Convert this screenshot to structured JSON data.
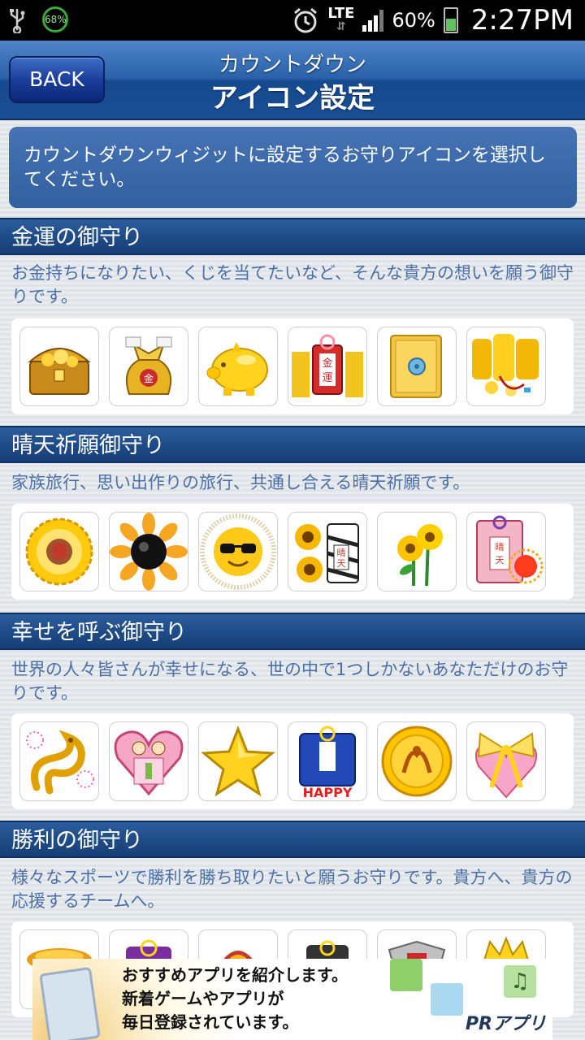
{
  "status_bar": {
    "battery_circle": "68%",
    "network": "LTE",
    "battery_percent": "60%",
    "time": "2:27PM"
  },
  "header": {
    "back_label": "BACK",
    "title_line1": "カウントダウン",
    "title_line2": "アイコン設定"
  },
  "info": {
    "text": "カウントダウンウィジットに設定するお守りアイコンを選択してください。"
  },
  "sections": [
    {
      "title": "金運の御守り",
      "description": "お金持ちになりたい、くじを当てたいなど、そんな貴方の想いを願う御守りです。",
      "icons": [
        "treasure-chest-icon",
        "money-bag-icon",
        "gold-piggy-bank-icon",
        "kinun-charm-icon",
        "gold-safe-icon",
        "gold-coins-icon"
      ]
    },
    {
      "title": "晴天祈願御守り",
      "description": "家族旅行、思い出作りの旅行、共通し合える晴天祈願です。",
      "icons": [
        "sun-frame-icon",
        "sunflower-black-icon",
        "sun-sunglasses-icon",
        "sunflower-charm-icon",
        "sunflowers-icon",
        "seiten-charm-icon"
      ]
    },
    {
      "title": "幸せを呼ぶ御守り",
      "description": "世界の人々皆さんが幸せになる、世の中で1つしかないあなただけのお守りです。",
      "icons": [
        "golden-dragon-icon",
        "pink-heart-charm-icon",
        "gold-star-icon",
        "happy-charm-icon",
        "dragon-medal-icon",
        "heart-ribbon-icon"
      ]
    },
    {
      "title": "勝利の御守り",
      "description": "様々なスポーツで勝利を勝ち取りたいと願うお守りです。貴方へ、貴方の応援するチームへ。",
      "icons": [
        "victory-icon-1",
        "victory-icon-2",
        "victory-icon-3",
        "victory-icon-4",
        "victory-icon-5",
        "victory-icon-6"
      ]
    }
  ],
  "ad": {
    "line1": "おすすめアプリを紹介します。",
    "line2": "新着ゲームやアプリが",
    "line3": "毎日登録されています。",
    "brand": "PRアプリ"
  },
  "colors": {
    "header_blue": "#2a61a8",
    "section_blue": "#1f4c88",
    "description_text": "#4a6fa8"
  }
}
